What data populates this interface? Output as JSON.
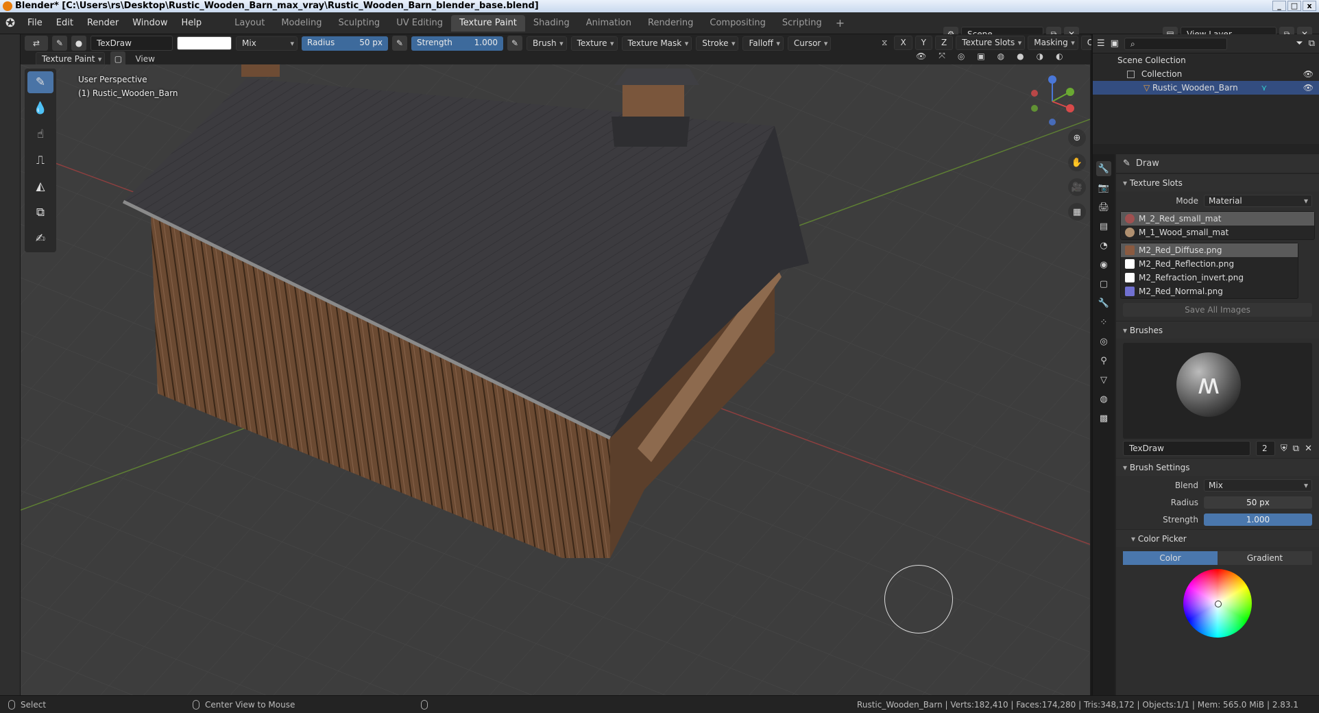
{
  "title": "Blender* [C:\\Users\\rs\\Desktop\\Rustic_Wooden_Barn_max_vray\\Rustic_Wooden_Barn_blender_base.blend]",
  "menu": [
    "File",
    "Edit",
    "Render",
    "Window",
    "Help"
  ],
  "workspaces": [
    "Layout",
    "Modeling",
    "Sculpting",
    "UV Editing",
    "Texture Paint",
    "Shading",
    "Animation",
    "Rendering",
    "Compositing",
    "Scripting"
  ],
  "active_workspace": "Texture Paint",
  "scene": "Scene",
  "view_layer": "View Layer",
  "tool_header": {
    "brush_name": "TexDraw",
    "blend": "Mix",
    "radius_label": "Radius",
    "radius_value": "50 px",
    "strength_label": "Strength",
    "strength_value": "1.000",
    "menus": [
      "Brush",
      "Texture",
      "Texture Mask",
      "Stroke",
      "Falloff",
      "Cursor"
    ],
    "axes": [
      "X",
      "Y",
      "Z"
    ],
    "right_menus": [
      "Texture Slots",
      "Masking",
      "Options"
    ]
  },
  "mode_header": {
    "mode": "Texture Paint",
    "view": "View"
  },
  "viewport": {
    "perspective": "User Perspective",
    "object": "(1) Rustic_Wooden_Barn"
  },
  "outliner": {
    "scene_collection": "Scene Collection",
    "collection": "Collection",
    "object": "Rustic_Wooden_Barn"
  },
  "properties": {
    "tool": "Draw",
    "texture_slots_title": "Texture Slots",
    "mode_label": "Mode",
    "mode_value": "Material",
    "materials": [
      "M_2_Red_small_mat",
      "M_1_Wood_small_mat"
    ],
    "images": [
      "M2_Red_Diffuse.png",
      "M2_Red_Reflection.png",
      "M2_Refraction_invert.png",
      "M2_Red_Normal.png"
    ],
    "save_all": "Save All Images",
    "brushes_title": "Brushes",
    "brush_name": "TexDraw",
    "brush_users": "2",
    "brush_settings_title": "Brush Settings",
    "blend_label": "Blend",
    "blend_value": "Mix",
    "radius_label": "Radius",
    "radius_value": "50 px",
    "strength_label": "Strength",
    "strength_value": "1.000",
    "color_picker_title": "Color Picker",
    "color_tab": "Color",
    "gradient_tab": "Gradient"
  },
  "status": {
    "select": "Select",
    "center_view": "Center View to Mouse",
    "stats": "Rustic_Wooden_Barn | Verts:182,410 | Faces:174,280 | Tris:348,172 | Objects:1/1 | Mem: 565.0 MiB | 2.83.1"
  },
  "colors": {
    "accent": "#4a77ad",
    "header_bg": "#2b2b2b",
    "viewport_bg": "#3d3d3d",
    "selection": "#334d80"
  }
}
